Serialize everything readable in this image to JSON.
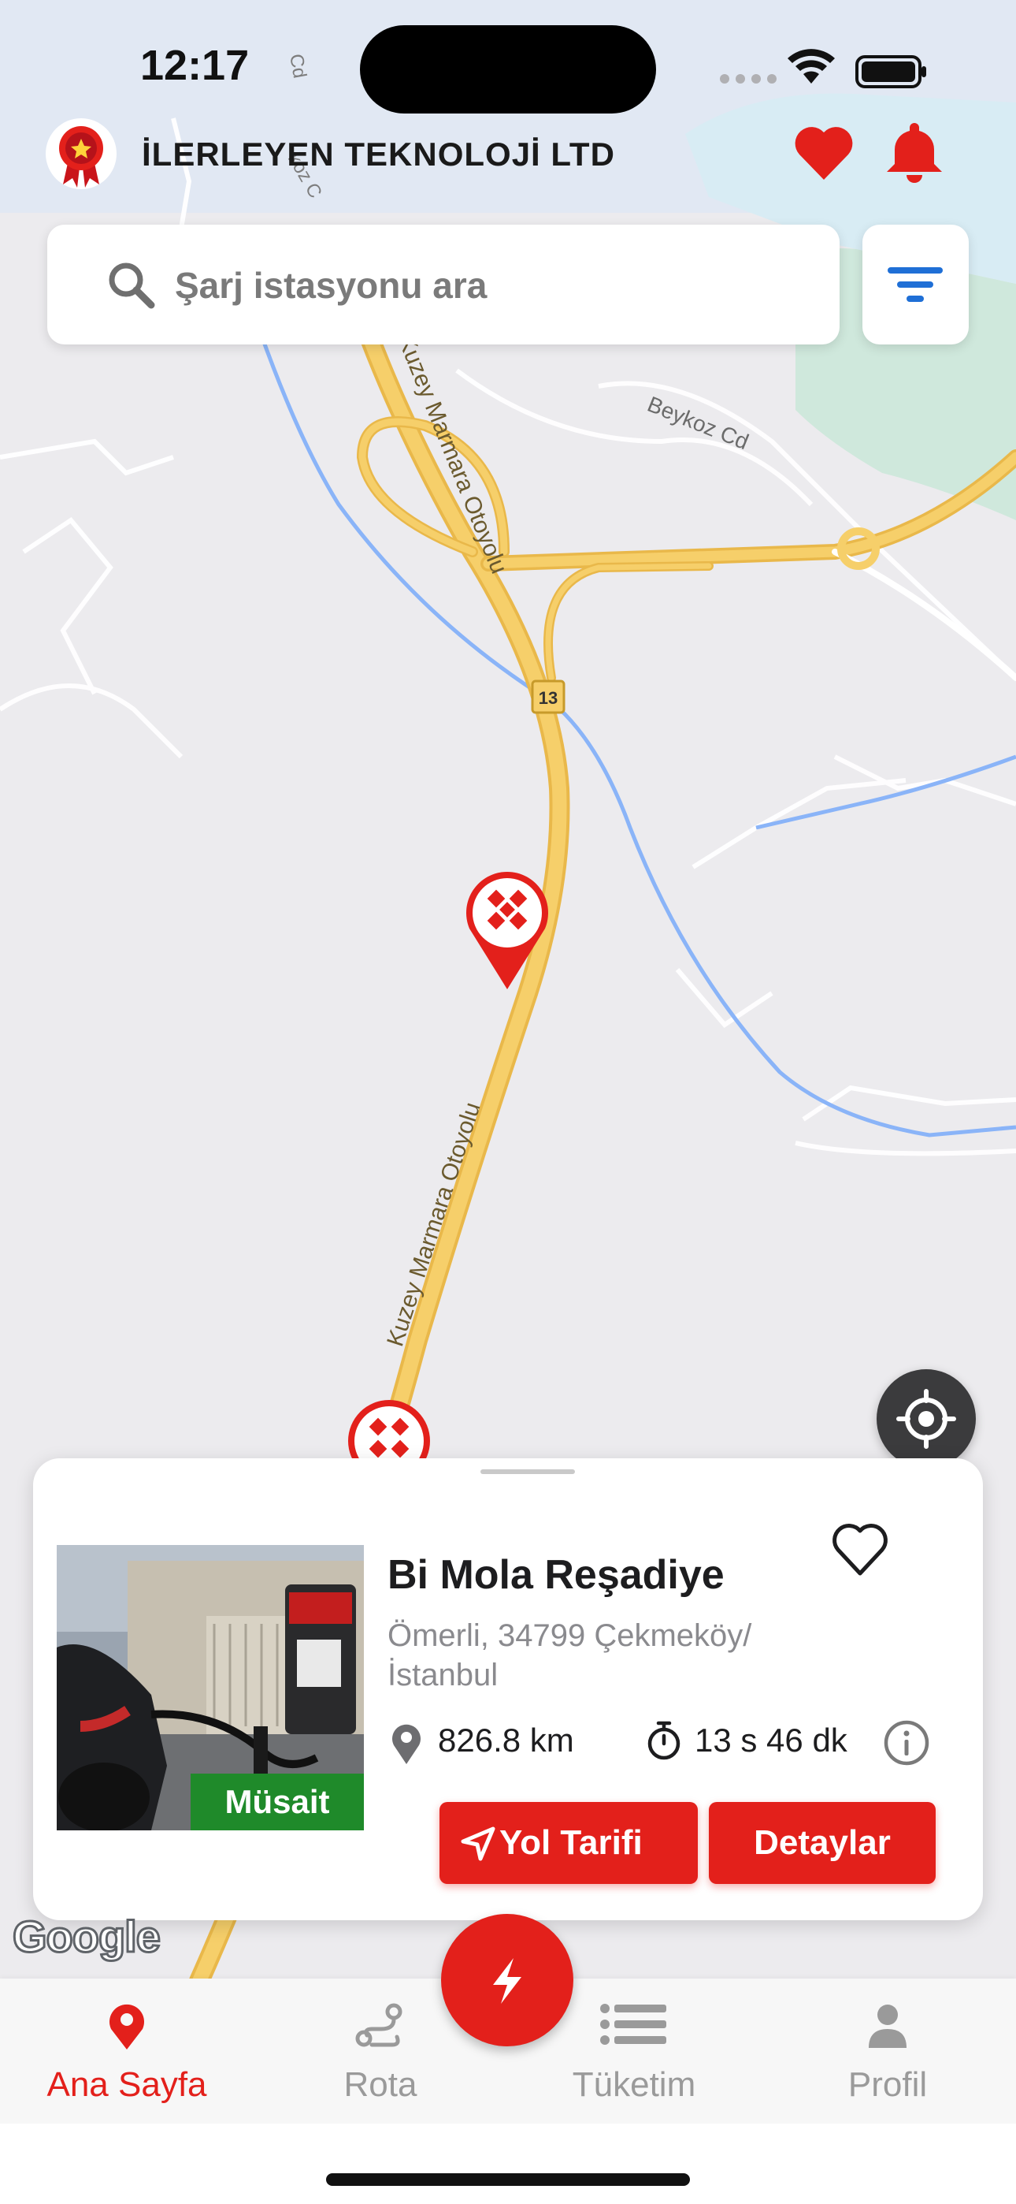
{
  "status_bar": {
    "time": "12:17"
  },
  "header": {
    "company_name": "İLERLEYEN TEKNOLOJİ LTD"
  },
  "search": {
    "placeholder": "Şarj istasyonu ara"
  },
  "map": {
    "labels": {
      "beykoz": "Beykoz Cd",
      "road_upper": "Kuzey Marmara Otoyolu",
      "road_lower": "Kuzey Marmara Otoyolu",
      "route_number": "13",
      "cd_label": "Cd",
      "koz_label": "koz C"
    },
    "attribution": "Google"
  },
  "station_card": {
    "name": "Bi Mola Reşadiye",
    "address": "Ömerli, 34799 Çekmeköy/\nİstanbul",
    "distance": "826.8 km",
    "duration": "13 s 46 dk",
    "status": "Müsait",
    "directions_label": "Yol Tarifi",
    "details_label": "Detaylar"
  },
  "tabs": [
    {
      "label": "Ana Sayfa",
      "icon": "map-pin-icon",
      "active": true
    },
    {
      "label": "Rota",
      "icon": "route-icon",
      "active": false
    },
    {
      "label": "Tüketim",
      "icon": "list-icon",
      "active": false
    },
    {
      "label": "Profil",
      "icon": "person-icon",
      "active": false
    }
  ],
  "colors": {
    "accent": "#e3201b",
    "available": "#1f8a2a",
    "road": "#f6cf6a",
    "water": "#8ab4f8"
  }
}
